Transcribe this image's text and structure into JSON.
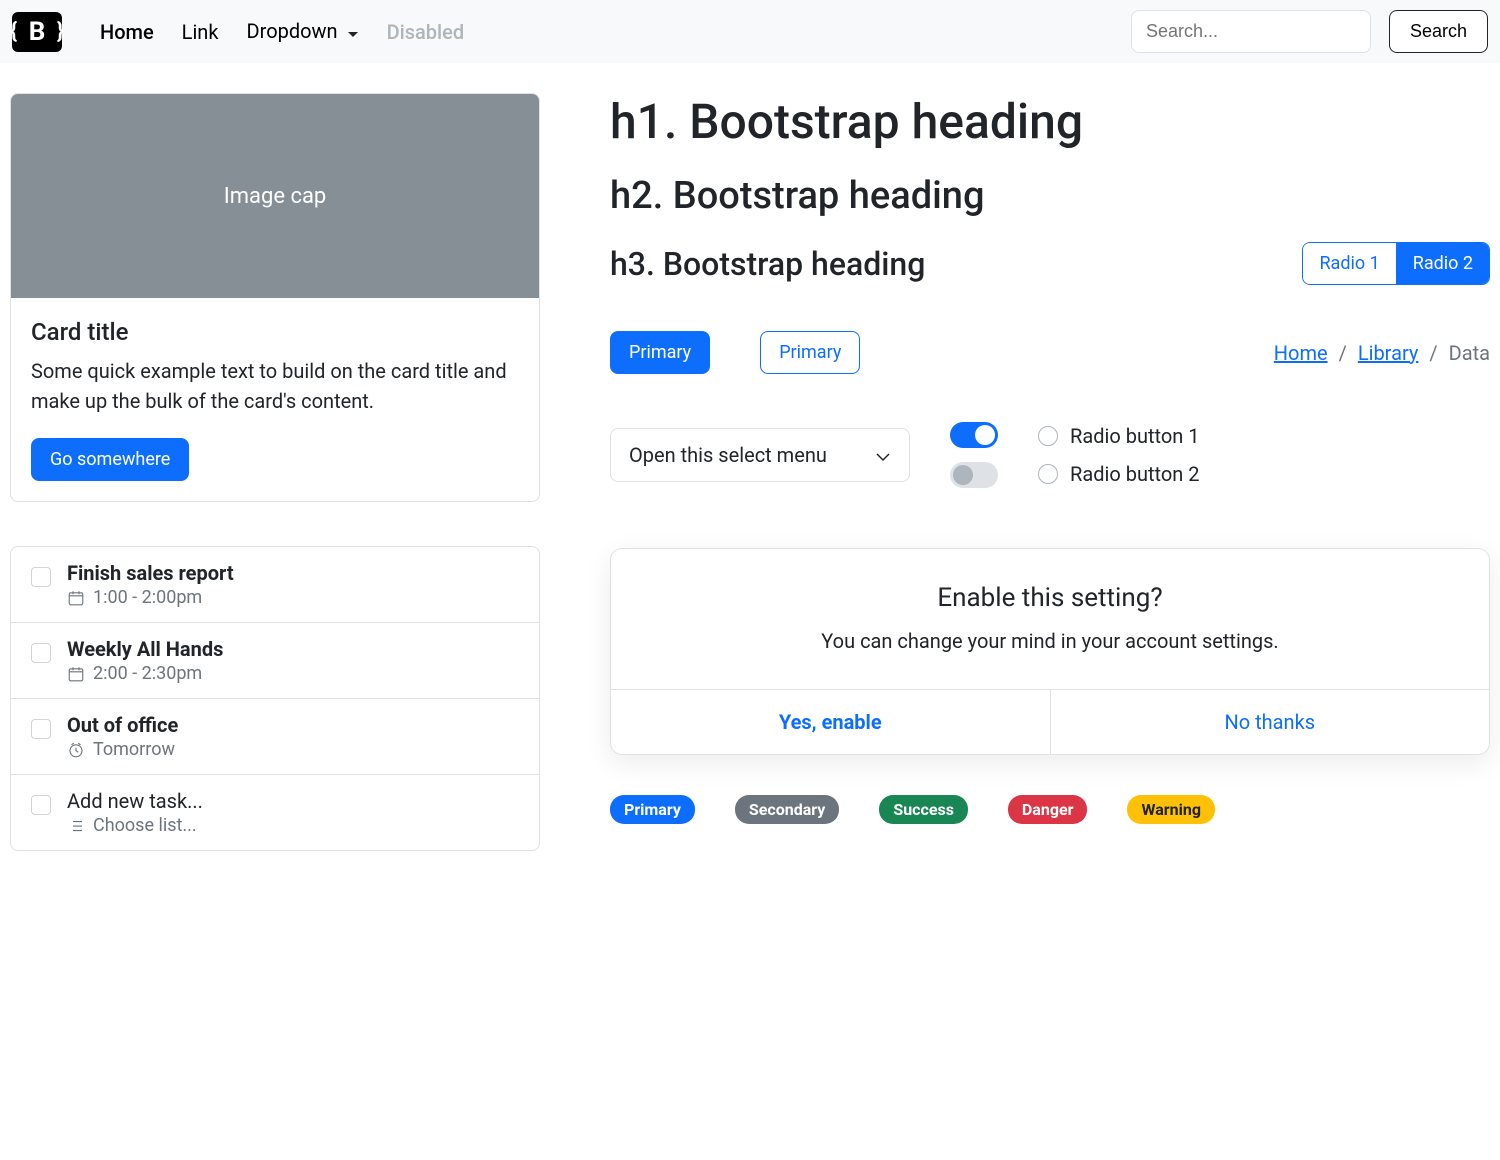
{
  "navbar": {
    "brand_letter": "B",
    "items": [
      "Home",
      "Link",
      "Dropdown",
      "Disabled"
    ],
    "search_placeholder": "Search...",
    "search_button": "Search"
  },
  "card": {
    "image_caption": "Image cap",
    "title": "Card title",
    "text": "Some quick example text to build on the card title and make up the bulk of the card's content.",
    "button": "Go somewhere"
  },
  "tasks": [
    {
      "title": "Finish sales report",
      "sub": "1:00 - 2:00pm",
      "icon": "calendar"
    },
    {
      "title": "Weekly All Hands",
      "sub": "2:00 - 2:30pm",
      "icon": "calendar"
    },
    {
      "title": "Out of office",
      "sub": "Tomorrow",
      "icon": "clock"
    },
    {
      "title": "Add new task...",
      "sub": "Choose list...",
      "icon": "list"
    }
  ],
  "headings": {
    "h1": "h1. Bootstrap heading",
    "h2": "h2. Bootstrap heading",
    "h3": "h3. Bootstrap heading"
  },
  "radio_buttons": {
    "r1": "Radio 1",
    "r2": "Radio 2",
    "active": "r2"
  },
  "buttons_row": {
    "primary": "Primary",
    "outline": "Primary"
  },
  "breadcrumb": {
    "home": "Home",
    "library": "Library",
    "data": "Data"
  },
  "select": {
    "label": "Open this select menu"
  },
  "toggles": {
    "top_on": true,
    "bottom_on": false
  },
  "radios_list": {
    "r1": "Radio button 1",
    "r2": "Radio button 2"
  },
  "modal": {
    "title": "Enable this setting?",
    "text": "You can change your mind in your account settings.",
    "confirm": "Yes, enable",
    "cancel": "No thanks"
  },
  "badges": {
    "primary": "Primary",
    "secondary": "Secondary",
    "success": "Success",
    "danger": "Danger",
    "warning": "Warning"
  }
}
